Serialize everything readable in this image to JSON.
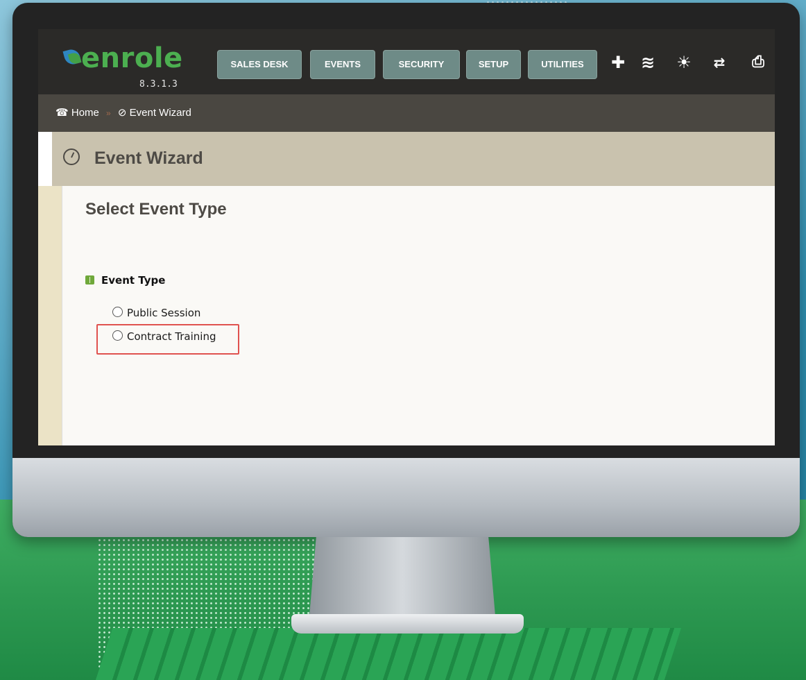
{
  "app": {
    "logo_text": "enrole",
    "version": "8.3.1.3"
  },
  "nav": {
    "buttons": [
      "SALES DESK",
      "EVENTS",
      "SECURITY",
      "SETUP",
      "UTILITIES"
    ],
    "icons": [
      "plus-icon",
      "layers-icon",
      "sun-icon",
      "sync-icon",
      "print-icon"
    ]
  },
  "breadcrumb": {
    "home": "Home",
    "current": "Event Wizard"
  },
  "page": {
    "title": "Event Wizard"
  },
  "form": {
    "section_title": "Select Event Type",
    "field_label": "Event Type",
    "options": [
      "Public Session",
      "Contract Training"
    ],
    "highlighted_option": "Contract Training"
  },
  "colors": {
    "nav_bg": "#2b2a28",
    "nav_button": "#6e8b87",
    "breadcrumb_bg": "#4a4741",
    "page_head_bg": "#c9c2ae",
    "logo_green": "#4caf50",
    "highlight": "#e0524f"
  }
}
